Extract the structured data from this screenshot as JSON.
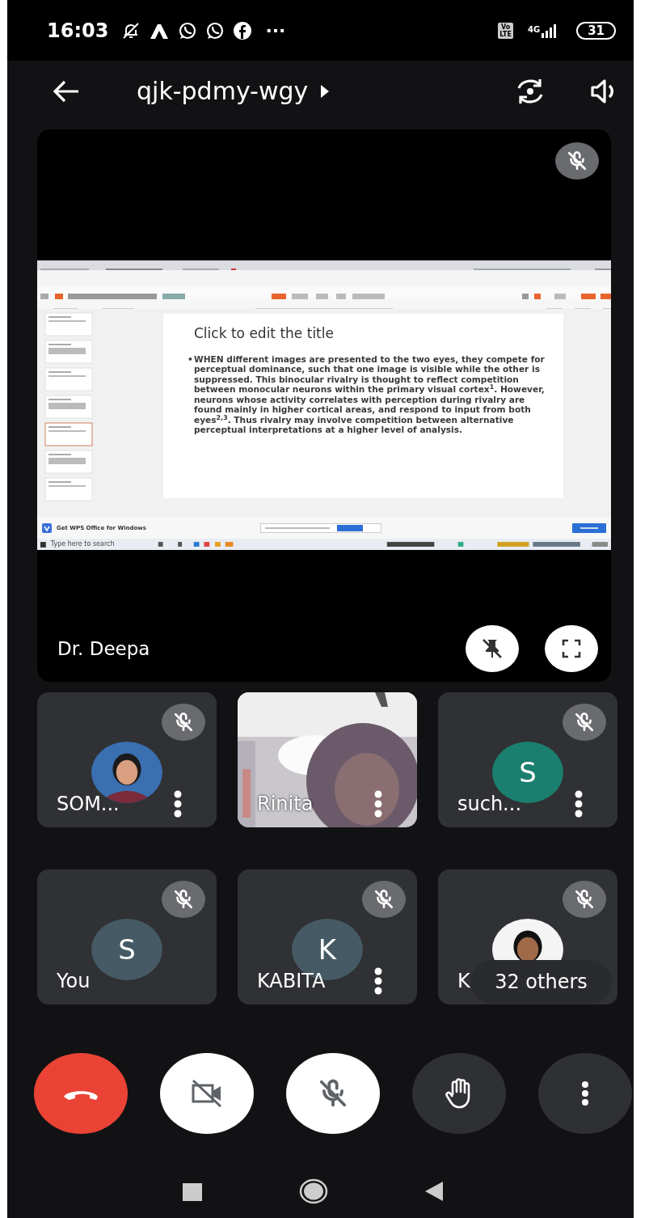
{
  "status_bar": {
    "time": "16:03",
    "more": "···",
    "volte": [
      "Vo",
      "LTE"
    ],
    "network": "4G",
    "battery": "31"
  },
  "header": {
    "meeting_code": "qjk-pdmy-wgy"
  },
  "presenter": {
    "name": "Dr. Deepa",
    "muted": true,
    "pinned": true,
    "shared_screen": {
      "slide_title": "Click to edit the title",
      "bullet": "•",
      "slide_text": "WHEN different images are presented to the two eyes, they compete for perceptual dominance, such that one image is visible while the other is suppressed. This binocular rivalry is thought to reflect competition between monocular neurons within the primary visual cortex$^{1}$. However, neurons whose activity correlates with perception during rivalry are found mainly in higher cortical areas, and respond to input from both eyes$^{2,3}$. Thus rivalry may involve competition between alternative perceptual interpretations at a higher level of analysis.",
      "banner": "Get WPS Office for Windows",
      "search_placeholder": "Type here to search"
    }
  },
  "participants": [
    {
      "name": "SOM...",
      "muted": true,
      "menu": true
    },
    {
      "name": "Rinita",
      "kind": "video",
      "muted": false,
      "menu": true
    },
    {
      "name": "such...",
      "kind": "letter",
      "initial": "S",
      "color": "#1a7f6f",
      "muted": true,
      "menu": true
    },
    {
      "name": "You",
      "kind": "letter",
      "initial": "S",
      "color": "#455a64",
      "muted": true,
      "menu": false
    },
    {
      "name": "KABITA",
      "kind": "letter",
      "initial": "K",
      "color": "#455a64",
      "muted": true,
      "menu": true
    },
    {
      "name": "K",
      "muted": true,
      "menu": false
    }
  ],
  "others": "32 others",
  "controls": [
    {
      "kind": "end_call"
    },
    {
      "kind": "camera",
      "on": false
    },
    {
      "kind": "mic",
      "on": false
    },
    {
      "kind": "hand"
    },
    {
      "kind": "more"
    }
  ]
}
